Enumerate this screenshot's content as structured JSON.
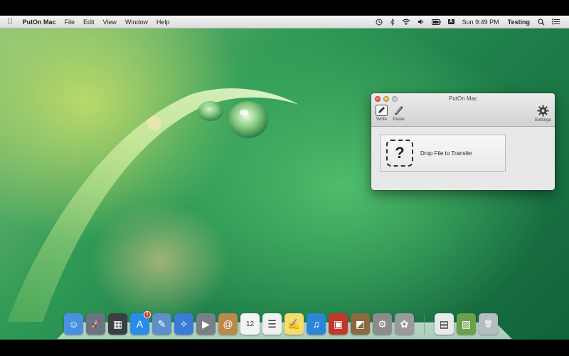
{
  "menubar": {
    "apple_glyph": "",
    "app_name": "PutOn Mac",
    "menus": [
      "File",
      "Edit",
      "View",
      "Window",
      "Help"
    ],
    "clock": "Sun 9:49 PM",
    "user": "Testing",
    "input_source": "A"
  },
  "window": {
    "title": "PutOn Mac",
    "toolbar": {
      "write_label": "Write",
      "paste_label": "Paste",
      "settings_label": "Settings"
    },
    "drop_zone": {
      "glyph": "?",
      "label": "Drop File to Transfer"
    }
  },
  "dock": {
    "apps": [
      {
        "name": "finder-icon",
        "color": "#4a90e2",
        "glyph": "☺"
      },
      {
        "name": "launchpad-icon",
        "color": "#6b7480",
        "glyph": "🚀"
      },
      {
        "name": "mission-control-icon",
        "color": "#3b3f45",
        "glyph": "▦"
      },
      {
        "name": "app-store-icon",
        "color": "#2b8ce8",
        "glyph": "A",
        "badge": "1"
      },
      {
        "name": "preview-icon",
        "color": "#5d8fc9",
        "glyph": "✎"
      },
      {
        "name": "safari-icon",
        "color": "#3a7bd5",
        "glyph": "✧"
      },
      {
        "name": "facetime-icon",
        "color": "#7a7f86",
        "glyph": "▶"
      },
      {
        "name": "contacts-icon",
        "color": "#b98a4b",
        "glyph": "@"
      },
      {
        "name": "calendar-icon",
        "color": "#f4f4f4",
        "glyph": "12"
      },
      {
        "name": "reminders-icon",
        "color": "#f0f0f0",
        "glyph": "☰"
      },
      {
        "name": "notes-icon",
        "color": "#f3dd6b",
        "glyph": "✍"
      },
      {
        "name": "itunes-icon",
        "color": "#2c86d8",
        "glyph": "♫"
      },
      {
        "name": "photo-booth-icon",
        "color": "#c0392b",
        "glyph": "▣"
      },
      {
        "name": "iphoto-icon",
        "color": "#8a6a3e",
        "glyph": "◩"
      },
      {
        "name": "system-preferences-icon",
        "color": "#8c8c8c",
        "glyph": "⚙"
      },
      {
        "name": "puton-mac-icon",
        "color": "#9a9a9a",
        "glyph": "✿"
      }
    ],
    "stacks": [
      {
        "name": "documents-stack-icon",
        "color": "#e9e9e9",
        "glyph": "▤"
      },
      {
        "name": "pictures-stack-icon",
        "color": "#6aa14a",
        "glyph": "▧"
      },
      {
        "name": "trash-icon",
        "color": "#b5bcc2",
        "glyph": "🗑"
      }
    ]
  }
}
